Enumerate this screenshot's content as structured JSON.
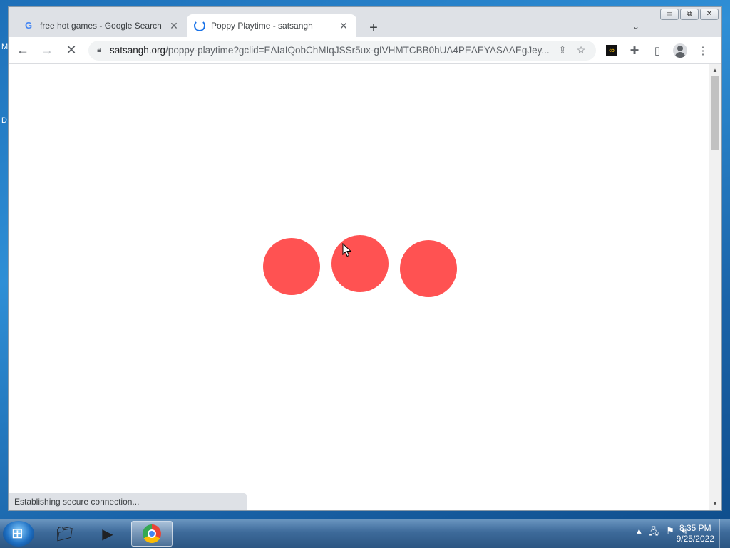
{
  "desktop": {
    "letter_top": "M",
    "letter_mid": "D"
  },
  "tabs": [
    {
      "title": "free hot games - Google Search",
      "favicon": "google-g-icon",
      "active": false
    },
    {
      "title": "Poppy Playtime - satsangh",
      "favicon": "loading-spinner-icon",
      "active": true
    }
  ],
  "window_controls": {
    "minimize": "▭",
    "restore": "⧉",
    "close": "✕"
  },
  "toolbar": {
    "url_host": "satsangh.org",
    "url_path": "/poppy-playtime?gclid=EAIaIQobChMIqJSSr5ux-gIVHMTCBB0hUA4PEAEYASAAEgJey..."
  },
  "status_text": "Establishing secure connection...",
  "loader": {
    "color": "#ff5252",
    "dot_count": 3
  },
  "taskbar": {
    "time": "8:35 PM",
    "date": "9/25/2022",
    "apps": [
      "file-explorer-icon",
      "media-player-icon",
      "chrome-icon"
    ]
  }
}
